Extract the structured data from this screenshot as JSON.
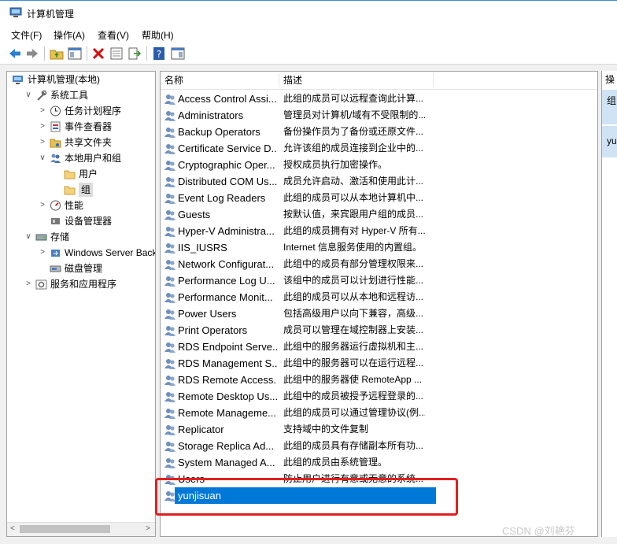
{
  "window": {
    "title": "计算机管理",
    "icon": "computer-management-icon"
  },
  "menu": [
    "文件(F)",
    "操作(A)",
    "查看(V)",
    "帮助(H)"
  ],
  "toolbar": {
    "buttons": [
      "back-arrow-icon",
      "forward-arrow-icon",
      "up-folder-icon",
      "show-hide-tree-icon",
      "delete-icon",
      "properties-icon",
      "export-icon",
      "help-icon",
      "action-pane-icon"
    ]
  },
  "tree": [
    {
      "label": "计算机管理(本地)",
      "level": 0,
      "expander": "",
      "icon": "computer-management-icon"
    },
    {
      "label": "系统工具",
      "level": 1,
      "expander": "∨",
      "icon": "tools-icon"
    },
    {
      "label": "任务计划程序",
      "level": 2,
      "expander": ">",
      "icon": "clock-icon"
    },
    {
      "label": "事件查看器",
      "level": 2,
      "expander": ">",
      "icon": "event-viewer-icon"
    },
    {
      "label": "共享文件夹",
      "level": 2,
      "expander": ">",
      "icon": "shared-folder-icon"
    },
    {
      "label": "本地用户和组",
      "level": 2,
      "expander": "∨",
      "icon": "users-group-icon"
    },
    {
      "label": "用户",
      "level": 3,
      "expander": "",
      "icon": "folder-icon"
    },
    {
      "label": "组",
      "level": 3,
      "expander": "",
      "icon": "folder-icon",
      "selected": true
    },
    {
      "label": "性能",
      "level": 2,
      "expander": ">",
      "icon": "performance-icon"
    },
    {
      "label": "设备管理器",
      "level": 2,
      "expander": "",
      "icon": "device-manager-icon"
    },
    {
      "label": "存储",
      "level": 1,
      "expander": "∨",
      "icon": "storage-icon"
    },
    {
      "label": "Windows Server Back",
      "level": 2,
      "expander": ">",
      "icon": "backup-icon"
    },
    {
      "label": "磁盘管理",
      "level": 2,
      "expander": "",
      "icon": "disk-icon"
    },
    {
      "label": "服务和应用程序",
      "level": 1,
      "expander": ">",
      "icon": "services-icon"
    }
  ],
  "list": {
    "columns": [
      "名称",
      "描述"
    ],
    "rows": [
      {
        "name": "Access Control Assi...",
        "desc": "此组的成员可以远程查询此计算..."
      },
      {
        "name": "Administrators",
        "desc": "管理员对计算机/域有不受限制的..."
      },
      {
        "name": "Backup Operators",
        "desc": "备份操作员为了备份或还原文件..."
      },
      {
        "name": "Certificate Service D...",
        "desc": "允许该组的成员连接到企业中的..."
      },
      {
        "name": "Cryptographic Oper...",
        "desc": "授权成员执行加密操作。"
      },
      {
        "name": "Distributed COM Us...",
        "desc": "成员允许启动、激活和使用此计..."
      },
      {
        "name": "Event Log Readers",
        "desc": "此组的成员可以从本地计算机中..."
      },
      {
        "name": "Guests",
        "desc": "按默认值，来宾跟用户组的成员..."
      },
      {
        "name": "Hyper-V Administra...",
        "desc": "此组的成员拥有对 Hyper-V 所有..."
      },
      {
        "name": "IIS_IUSRS",
        "desc": "Internet 信息服务使用的内置组。"
      },
      {
        "name": "Network Configurat...",
        "desc": "此组中的成员有部分管理权限来..."
      },
      {
        "name": "Performance Log U...",
        "desc": "该组中的成员可以计划进行性能..."
      },
      {
        "name": "Performance Monit...",
        "desc": "此组的成员可以从本地和远程访..."
      },
      {
        "name": "Power Users",
        "desc": "包括高级用户以向下兼容，高级..."
      },
      {
        "name": "Print Operators",
        "desc": "成员可以管理在域控制器上安装..."
      },
      {
        "name": "RDS Endpoint Serve...",
        "desc": "此组中的服务器运行虚拟机和主..."
      },
      {
        "name": "RDS Management S...",
        "desc": "此组中的服务器可以在运行远程..."
      },
      {
        "name": "RDS Remote Access...",
        "desc": "此组中的服务器使 RemoteApp ..."
      },
      {
        "name": "Remote Desktop Us...",
        "desc": "此组中的成员被授予远程登录的..."
      },
      {
        "name": "Remote Manageme...",
        "desc": "此组的成员可以通过管理协议(例..."
      },
      {
        "name": "Replicator",
        "desc": "支持域中的文件复制"
      },
      {
        "name": "Storage Replica Ad...",
        "desc": "此组的成员具有存储副本所有功..."
      },
      {
        "name": "System Managed A...",
        "desc": "此组的成员由系统管理。"
      },
      {
        "name": "Users",
        "desc": "防止用户进行有意或无意的系统..."
      },
      {
        "name": "yunjisuan",
        "desc": "",
        "selected": true
      }
    ]
  },
  "action_pane": {
    "header": "操",
    "item1": "组",
    "item2": "yu"
  },
  "watermark": "CSDN @刘艳芬",
  "colors": {
    "selection": "#0078d7",
    "highlight_box": "#e02020"
  }
}
